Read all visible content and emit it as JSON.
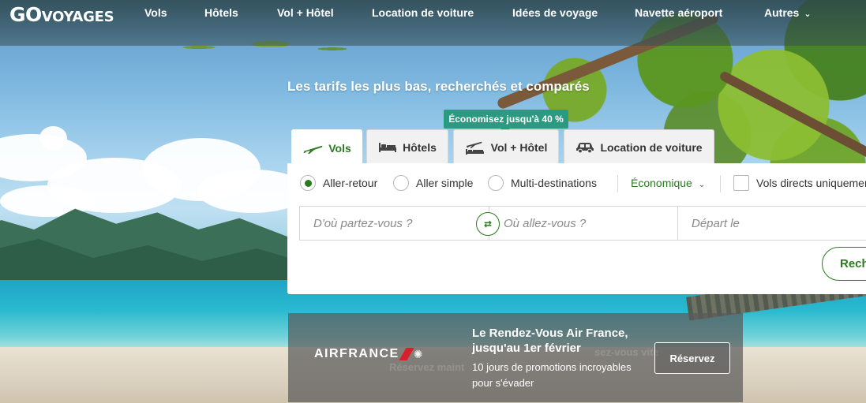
{
  "brand": {
    "logo_go": "GO",
    "logo_voyages": "VOYAGES"
  },
  "nav": {
    "items": [
      "Vols",
      "Hôtels",
      "Vol + Hôtel",
      "Location de voiture",
      "Idées de voyage",
      "Navette aéroport"
    ],
    "more_label": "Autres"
  },
  "hero": {
    "tagline": "Les tarifs les plus bas, recherchés et comparés",
    "promo_badge": "Économisez jusqu'à 40 %"
  },
  "tabs": [
    {
      "label": "Vols",
      "icon": "plane-icon",
      "active": true
    },
    {
      "label": "Hôtels",
      "icon": "bed-icon",
      "active": false
    },
    {
      "label": "Vol + Hôtel",
      "icon": "plane-hotel-icon",
      "active": false
    },
    {
      "label": "Location de voiture",
      "icon": "car-icon",
      "active": false
    }
  ],
  "search": {
    "trip_types": [
      {
        "label": "Aller-retour",
        "checked": true
      },
      {
        "label": "Aller simple",
        "checked": false
      },
      {
        "label": "Multi-destinations",
        "checked": false
      }
    ],
    "cabin_class": "Économique",
    "direct_flights_label": "Vols directs uniquement",
    "direct_flights_checked": false,
    "origin_placeholder": "D'où partez-vous ?",
    "destination_placeholder": "Où allez-vous ?",
    "departure_placeholder": "Départ le",
    "submit_label": "Rechercher"
  },
  "promo": {
    "logo_text": "AIRFRANCE",
    "title": "Le Rendez-Vous Air France, jusqu'au 1er février",
    "subtitle": "10 jours de promotions incroyables pour s'évader",
    "cta_label": "Réservez",
    "ghost_texts": [
      "Réservez maint",
      "sez-vous vite"
    ]
  },
  "colors": {
    "accent_green": "#2a7a1f",
    "badge_teal": "#2a9a80",
    "airfrance_red": "#d6202a"
  }
}
